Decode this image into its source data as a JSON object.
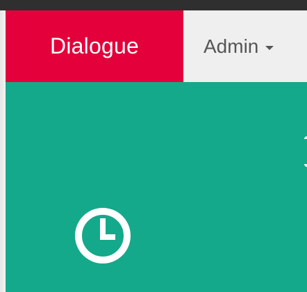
{
  "navbar": {
    "brand_label": "Dialogue",
    "admin_label": "Admin"
  },
  "colors": {
    "brand_bg": "#e4003b",
    "admin_bg": "#efefef",
    "hero_bg": "#15a98b",
    "icon": "#ffffff",
    "topbar": "#2f2f2f"
  },
  "icons": {
    "clock": "clock-icon",
    "caret": "chevron-down-icon"
  }
}
